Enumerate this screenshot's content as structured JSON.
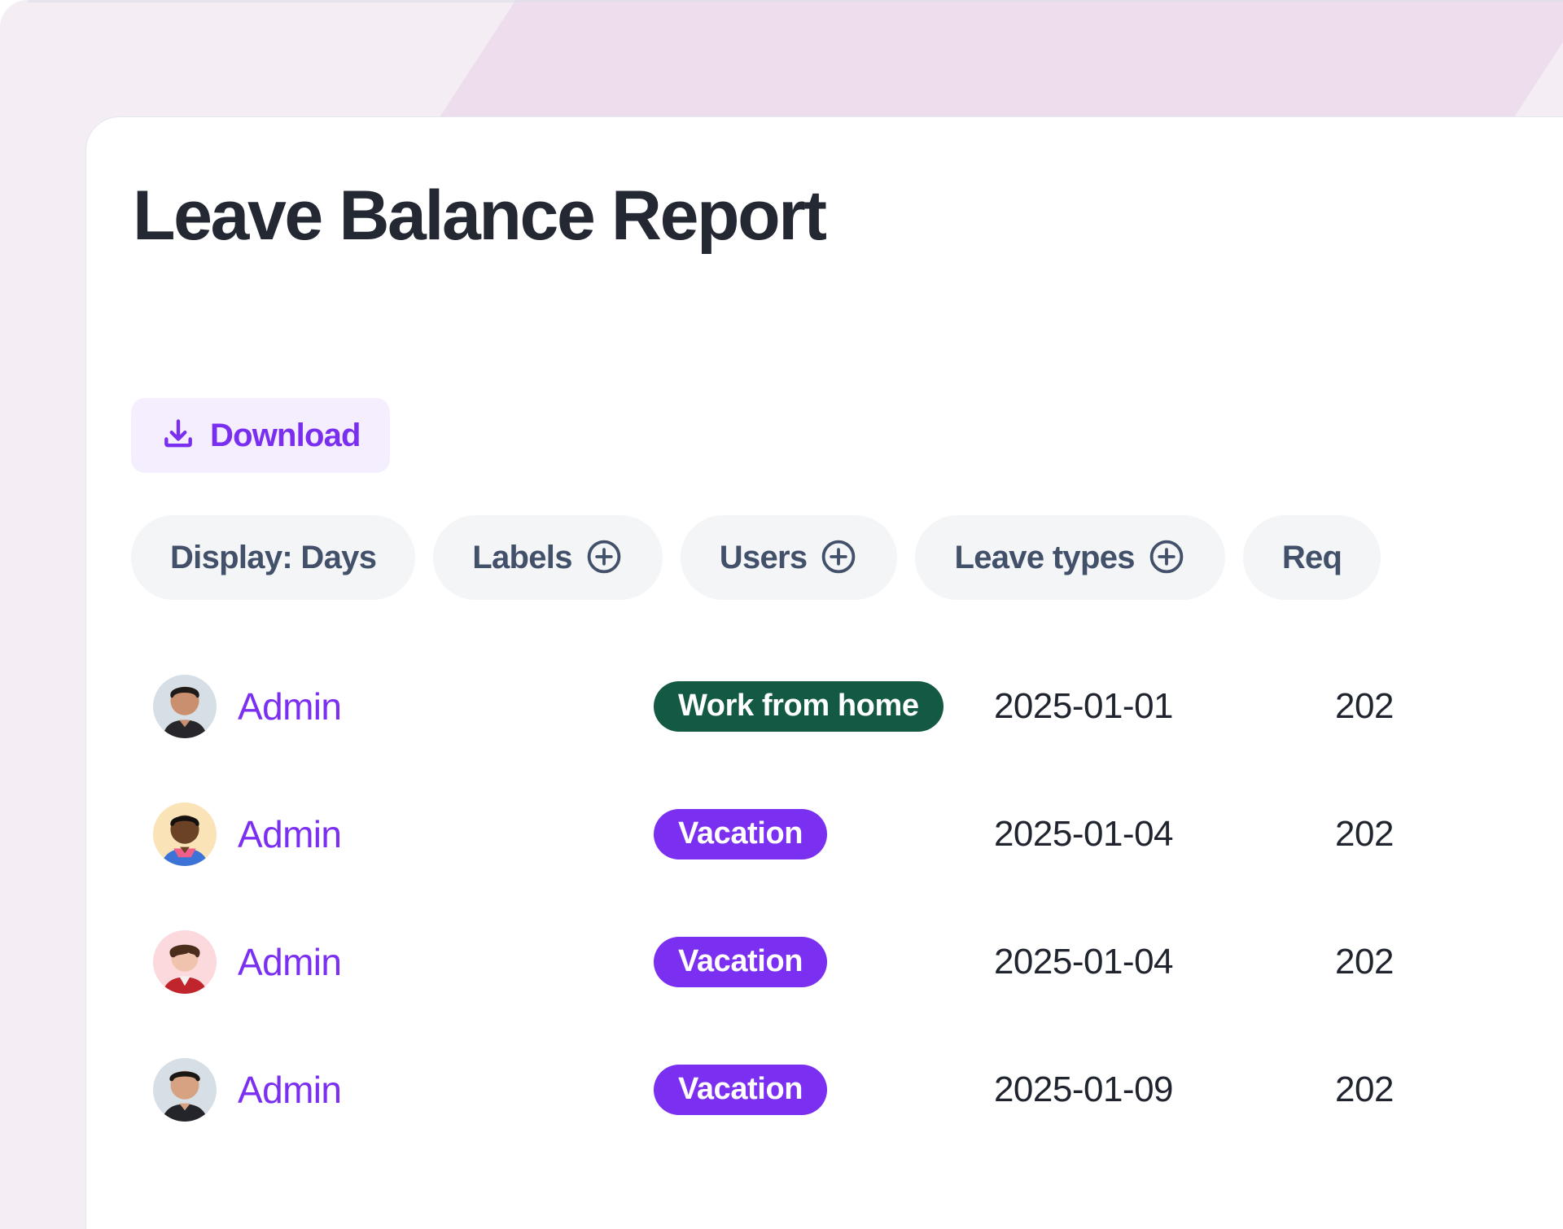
{
  "page": {
    "title": "Leave Balance Report",
    "background_color": "#f5edf4",
    "wedge_color": "#eeddec",
    "card_color": "#ffffff",
    "accent_color": "#7b2ff0"
  },
  "toolbar": {
    "download_label": "Download",
    "download_icon": "download-icon",
    "download_text_color": "#7a2ff0",
    "download_bg_color": "#f5eefe"
  },
  "filters": {
    "chips": [
      {
        "label": "Display: Days",
        "has_plus": false,
        "plus_icon": ""
      },
      {
        "label": "Labels",
        "has_plus": true,
        "plus_icon": "circle-plus-icon"
      },
      {
        "label": "Users",
        "has_plus": true,
        "plus_icon": "circle-plus-icon"
      },
      {
        "label": "Leave types",
        "has_plus": true,
        "plus_icon": "circle-plus-icon"
      },
      {
        "label": "Req",
        "has_plus": false,
        "plus_icon": ""
      }
    ]
  },
  "table": {
    "rows": [
      {
        "user": "Admin",
        "avatar": "avatar-man-dark-shirt",
        "avatar_bg": "#d7dfe6",
        "leave_type": "Work from home",
        "badge_color": "#145943",
        "date_from": "2025-01-01",
        "date_to": "202"
      },
      {
        "user": "Admin",
        "avatar": "avatar-man-blue-pink-shirt",
        "avatar_bg": "#fbe3b8",
        "leave_type": "Vacation",
        "badge_color": "#7b2ff0",
        "date_from": "2025-01-04",
        "date_to": "202"
      },
      {
        "user": "Admin",
        "avatar": "avatar-curly-red-jacket",
        "avatar_bg": "#fbd9dc",
        "leave_type": "Vacation",
        "badge_color": "#7b2ff0",
        "date_from": "2025-01-04",
        "date_to": "202"
      },
      {
        "user": "Admin",
        "avatar": "avatar-man-black-top",
        "avatar_bg": "#d7dfe6",
        "leave_type": "Vacation",
        "badge_color": "#7b2ff0",
        "date_from": "2025-01-09",
        "date_to": "202"
      }
    ]
  }
}
